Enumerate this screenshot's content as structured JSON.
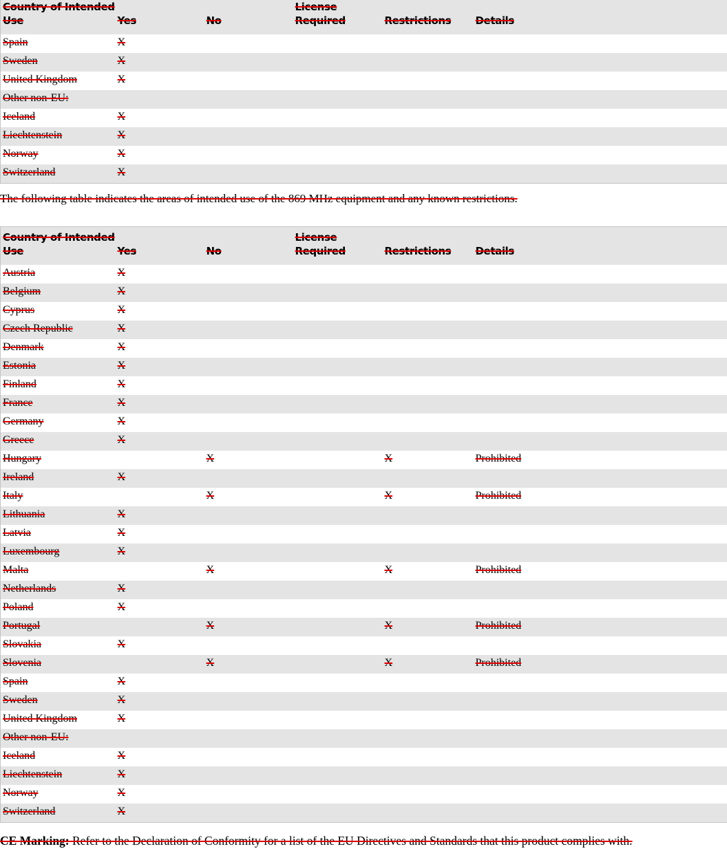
{
  "columns": [
    "Country of Intended Use",
    "Yes",
    "No",
    "License Required",
    "Restrictions",
    "Details"
  ],
  "table1": {
    "rows": [
      {
        "country": "Spain",
        "yes": "X",
        "no": "",
        "license": "",
        "restrictions": "",
        "details": ""
      },
      {
        "country": "Sweden",
        "yes": "X",
        "no": "",
        "license": "",
        "restrictions": "",
        "details": ""
      },
      {
        "country": "United Kingdom",
        "yes": "X",
        "no": "",
        "license": "",
        "restrictions": "",
        "details": ""
      },
      {
        "country": "Other non-EU:",
        "yes": "",
        "no": "",
        "license": "",
        "restrictions": "",
        "details": ""
      },
      {
        "country": "Iceland",
        "yes": "X",
        "no": "",
        "license": "",
        "restrictions": "",
        "details": ""
      },
      {
        "country": "Liechtenstein",
        "yes": "X",
        "no": "",
        "license": "",
        "restrictions": "",
        "details": ""
      },
      {
        "country": "Norway",
        "yes": "X",
        "no": "",
        "license": "",
        "restrictions": "",
        "details": ""
      },
      {
        "country": "Switzerland",
        "yes": "X",
        "no": "",
        "license": "",
        "restrictions": "",
        "details": ""
      }
    ]
  },
  "intro_text": "The following table indicates the areas of intended use of the 869 MHz equipment and any known restrictions.",
  "table2": {
    "rows": [
      {
        "country": "Austria",
        "yes": "X",
        "no": "",
        "license": "",
        "restrictions": "",
        "details": ""
      },
      {
        "country": "Belgium",
        "yes": "X",
        "no": "",
        "license": "",
        "restrictions": "",
        "details": ""
      },
      {
        "country": "Cyprus",
        "yes": "X",
        "no": "",
        "license": "",
        "restrictions": "",
        "details": ""
      },
      {
        "country": "Czech Republic",
        "yes": "X",
        "no": "",
        "license": "",
        "restrictions": "",
        "details": ""
      },
      {
        "country": "Denmark",
        "yes": "X",
        "no": "",
        "license": "",
        "restrictions": "",
        "details": ""
      },
      {
        "country": "Estonia",
        "yes": "X",
        "no": "",
        "license": "",
        "restrictions": "",
        "details": ""
      },
      {
        "country": "Finland",
        "yes": "X",
        "no": "",
        "license": "",
        "restrictions": "",
        "details": ""
      },
      {
        "country": "France",
        "yes": "X",
        "no": "",
        "license": "",
        "restrictions": "",
        "details": ""
      },
      {
        "country": "Germany",
        "yes": "X",
        "no": "",
        "license": "",
        "restrictions": "",
        "details": ""
      },
      {
        "country": "Greece",
        "yes": "X",
        "no": "",
        "license": "",
        "restrictions": "",
        "details": ""
      },
      {
        "country": "Hungary",
        "yes": "",
        "no": "X",
        "license": "",
        "restrictions": "X",
        "details": "Prohibited"
      },
      {
        "country": "Ireland",
        "yes": "X",
        "no": "",
        "license": "",
        "restrictions": "",
        "details": ""
      },
      {
        "country": "Italy",
        "yes": "",
        "no": "X",
        "license": "",
        "restrictions": "X",
        "details": "Prohibited"
      },
      {
        "country": "Lithuania",
        "yes": "X",
        "no": "",
        "license": "",
        "restrictions": "",
        "details": ""
      },
      {
        "country": "Latvia",
        "yes": "X",
        "no": "",
        "license": "",
        "restrictions": "",
        "details": ""
      },
      {
        "country": "Luxembourg",
        "yes": "X",
        "no": "",
        "license": "",
        "restrictions": "",
        "details": ""
      },
      {
        "country": "Malta",
        "yes": "",
        "no": "X",
        "license": "",
        "restrictions": "X",
        "details": "Prohibited"
      },
      {
        "country": "Netherlands",
        "yes": "X",
        "no": "",
        "license": "",
        "restrictions": "",
        "details": ""
      },
      {
        "country": "Poland",
        "yes": "X",
        "no": "",
        "license": "",
        "restrictions": "",
        "details": ""
      },
      {
        "country": "Portugal",
        "yes": "",
        "no": "X",
        "license": "",
        "restrictions": "X",
        "details": "Prohibited"
      },
      {
        "country": "Slovakia",
        "yes": "X",
        "no": "",
        "license": "",
        "restrictions": "",
        "details": ""
      },
      {
        "country": "Slovenia",
        "yes": "",
        "no": "X",
        "license": "",
        "restrictions": "X",
        "details": "Prohibited"
      },
      {
        "country": "Spain",
        "yes": "X",
        "no": "",
        "license": "",
        "restrictions": "",
        "details": ""
      },
      {
        "country": "Sweden",
        "yes": "X",
        "no": "",
        "license": "",
        "restrictions": "",
        "details": ""
      },
      {
        "country": "United Kingdom",
        "yes": "X",
        "no": "",
        "license": "",
        "restrictions": "",
        "details": ""
      },
      {
        "country": "Other non-EU:",
        "yes": "",
        "no": "",
        "license": "",
        "restrictions": "",
        "details": ""
      },
      {
        "country": "Iceland",
        "yes": "X",
        "no": "",
        "license": "",
        "restrictions": "",
        "details": ""
      },
      {
        "country": "Liechtenstein",
        "yes": "X",
        "no": "",
        "license": "",
        "restrictions": "",
        "details": ""
      },
      {
        "country": "Norway",
        "yes": "X",
        "no": "",
        "license": "",
        "restrictions": "",
        "details": ""
      },
      {
        "country": "Switzerland",
        "yes": "X",
        "no": "",
        "license": "",
        "restrictions": "",
        "details": ""
      }
    ]
  },
  "ce_marking": {
    "label": "CE Marking:",
    "text": " Refer to the Declaration of Conformity for a list of the EU Directives and Standards that this product complies with."
  },
  "colors": {
    "strikethrough": "#e00000",
    "stripe": "#e4e4e4",
    "border": "#c4c4c4"
  }
}
